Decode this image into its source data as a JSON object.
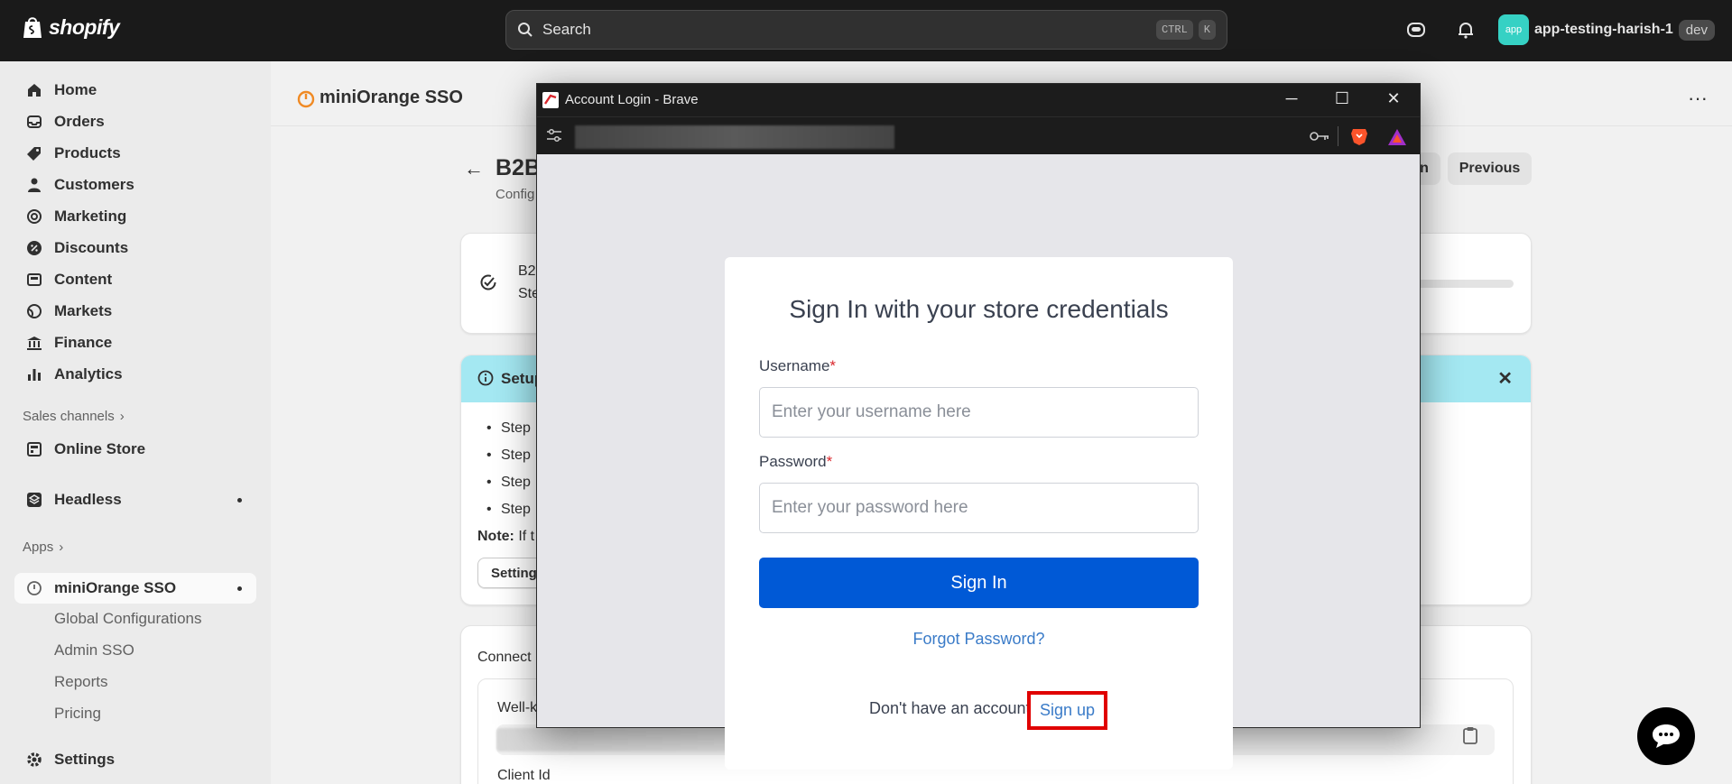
{
  "topbar": {
    "brand": "shopify",
    "search_placeholder": "Search",
    "kbd_ctrl": "CTRL",
    "kbd_k": "K",
    "store_avatar": "app",
    "store_name": "app-testing-harish-1",
    "store_badge": "dev"
  },
  "sidebar": {
    "items": [
      {
        "label": "Home",
        "icon": "home-icon"
      },
      {
        "label": "Orders",
        "icon": "orders-icon"
      },
      {
        "label": "Products",
        "icon": "tag-icon"
      },
      {
        "label": "Customers",
        "icon": "person-icon"
      },
      {
        "label": "Marketing",
        "icon": "target-icon"
      },
      {
        "label": "Discounts",
        "icon": "discount-icon"
      },
      {
        "label": "Content",
        "icon": "content-icon"
      },
      {
        "label": "Markets",
        "icon": "globe-icon"
      },
      {
        "label": "Finance",
        "icon": "bank-icon"
      },
      {
        "label": "Analytics",
        "icon": "chart-icon"
      }
    ],
    "sales_channels_label": "Sales channels",
    "online_store": "Online Store",
    "headless": "Headless",
    "apps_label": "Apps",
    "app_name": "miniOrange SSO",
    "app_sub": [
      "Global Configurations",
      "Admin SSO",
      "Reports",
      "Pricing"
    ],
    "settings": "Settings"
  },
  "main": {
    "app_title": "miniOrange SSO",
    "page_title": "B2B",
    "page_subtitle": "Config",
    "prev_button": "Previous",
    "prev_button_left": "n",
    "card1_line1": "B2",
    "card1_line2": "Ste",
    "banner_title": "Setup",
    "steps": [
      "Step",
      "Step",
      "Step",
      "Step"
    ],
    "note_label": "Note:",
    "note_text": " If t",
    "settings_button": "Setting",
    "connect_label": "Connect",
    "well_label": "Well-k",
    "client_id_label": "Client Id"
  },
  "popup": {
    "window_title": "Account Login - Brave",
    "heading": "Sign In with your store credentials",
    "username_label": "Username",
    "password_label": "Password",
    "required_mark": "*",
    "username_placeholder": "Enter your username here",
    "password_placeholder": "Enter your password here",
    "signin_button": "Sign In",
    "forgot": "Forgot Password?",
    "no_account": "Don't have an account",
    "signup": "Sign up"
  },
  "colors": {
    "topbar_bg": "#1a1a1a",
    "signin_blue": "#0059d6",
    "link_blue": "#3a7bc8",
    "highlight_red": "#e00000",
    "banner_cyan": "#a4e8f2"
  }
}
